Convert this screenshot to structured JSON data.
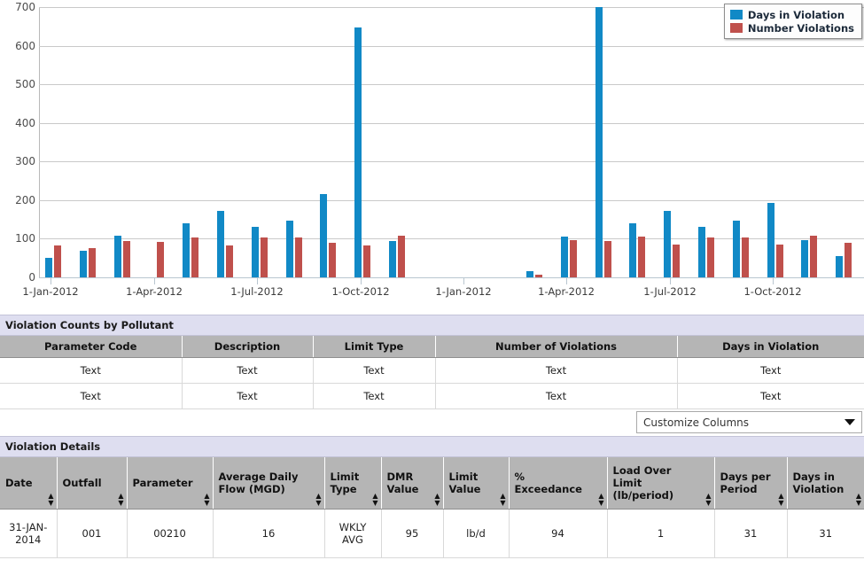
{
  "chart_data": {
    "type": "bar",
    "title": "",
    "xlabel": "",
    "ylabel": "",
    "ylim": [
      0,
      700
    ],
    "ytick_values": [
      0,
      100,
      200,
      300,
      400,
      500,
      600,
      700
    ],
    "grid": true,
    "legend_position": "top-right",
    "legend": [
      "Days in Violation",
      "Number Violations"
    ],
    "colors": {
      "days_in_violation": "#1189c6",
      "number_violations": "#bf504c"
    },
    "xtick_labels": [
      "1-Jan-2012",
      "1-Apr-2012",
      "1-Jul-2012",
      "1-Oct-2012",
      "1-Jan-2012",
      "1-Apr-2012",
      "1-Jul-2012",
      "1-Oct-2012"
    ],
    "categories": [
      "1-Jan-2012",
      "1-Feb-2012",
      "1-Mar-2012",
      "1-Apr-2012",
      "1-May-2012",
      "1-Jun-2012",
      "1-Jul-2012",
      "1-Aug-2012",
      "1-Sep-2012",
      "1-Oct-2012",
      "1-Nov-2012",
      "1-Dec-2012",
      "1-Jan-2013",
      "1-Feb-2013",
      "1-Mar-2013",
      "1-Apr-2013",
      "1-May-2013",
      "1-Jun-2013",
      "1-Jul-2013",
      "1-Aug-2013",
      "1-Sep-2013",
      "1-Oct-2013",
      "1-Nov-2013",
      "1-Dec-2013"
    ],
    "series": [
      {
        "name": "Days in Violation",
        "values": [
          50,
          70,
          107,
          0,
          141,
          173,
          131,
          147,
          215,
          648,
          95,
          0,
          0,
          0,
          16,
          106,
          740,
          141,
          172,
          132,
          146,
          193,
          96,
          56
        ]
      },
      {
        "name": "Number Violations",
        "values": [
          82,
          75,
          95,
          92,
          103,
          83,
          103,
          103,
          90,
          83,
          107,
          0,
          0,
          0,
          8,
          96,
          95,
          105,
          84,
          104,
          104,
          86,
          107,
          89
        ]
      }
    ],
    "notes": "Tallest blue bar near 1-Apr-2013 extends beyond the 700 axis maximum (clipped)."
  },
  "counts_panel": {
    "title": "Violation Counts by Pollutant",
    "columns": [
      "Parameter Code",
      "Description",
      "Limit Type",
      "Number of Violations",
      "Days in Violation"
    ],
    "rows": [
      [
        "Text",
        "Text",
        "Text",
        "Text",
        "Text"
      ],
      [
        "Text",
        "Text",
        "Text",
        "Text",
        "Text"
      ]
    ]
  },
  "customize": {
    "label": "Customize Columns",
    "caret_icon": "chevron-down-icon"
  },
  "details_panel": {
    "title": "Violation Details",
    "columns": [
      "Date",
      "Outfall",
      "Parameter",
      "Average Daily Flow (MGD)",
      "Limit Type",
      "DMR Value",
      "Limit Value",
      "% Exceedance",
      "Load Over Limit (lb/period)",
      "Days per Period",
      "Days in Violation"
    ],
    "sort_icon": "sort-updown-icon",
    "rows": [
      [
        "31-JAN-2014",
        "001",
        "00210",
        "16",
        "WKLY AVG",
        "95",
        "lb/d",
        "94",
        "1",
        "31",
        "31"
      ]
    ]
  }
}
